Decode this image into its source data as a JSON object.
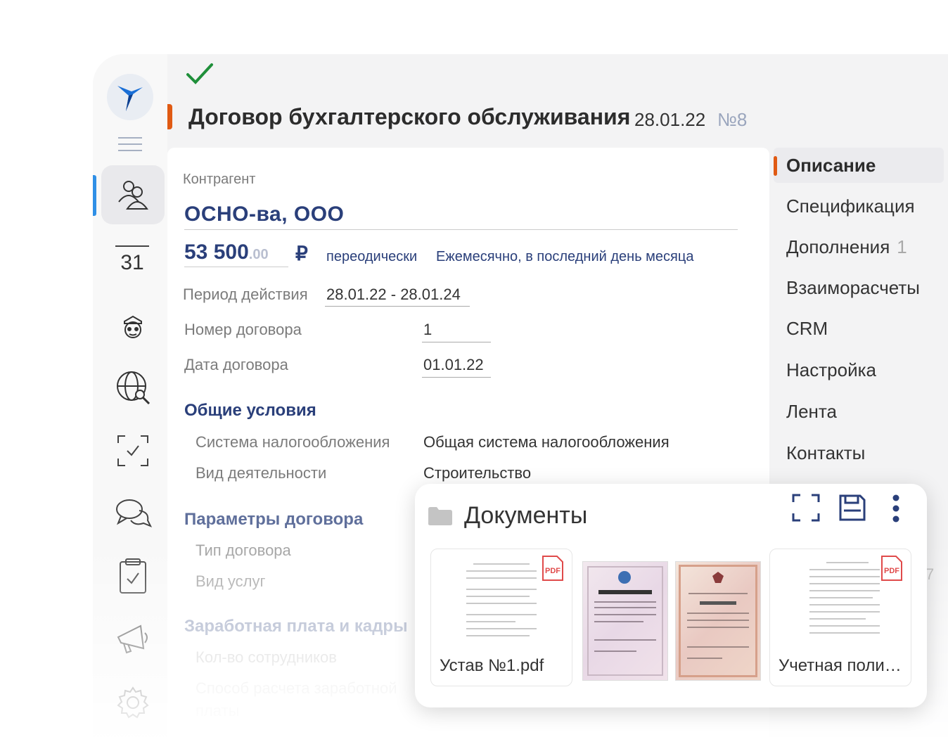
{
  "header": {
    "title": "Договор бухгалтерского обслуживания",
    "date": "28.01.22",
    "number": "№8"
  },
  "sidebar": {
    "calendar_day": "31",
    "items": [
      "users-icon",
      "calendar-icon",
      "agent-icon",
      "globe-search-icon",
      "task-check-icon",
      "chat-icon",
      "clipboard-icon",
      "megaphone-icon",
      "gear-icon"
    ]
  },
  "form": {
    "counterparty_label": "Контрагент",
    "counterparty_value": "ОСНО-ва, ООО",
    "amount_main": "53 500",
    "amount_decimals": ".00",
    "currency": "₽",
    "periodic_label": "переодически",
    "periodic_value": "Ежемесячно, в последний день месяца",
    "period_label": "Период действия",
    "period_value": "28.01.22 - 28.01.24",
    "contract_number_label": "Номер договора",
    "contract_number_value": "1",
    "contract_date_label": "Дата договора",
    "contract_date_value": "01.01.22",
    "section_general": "Общие условия",
    "tax_system_label": "Система налогообложения",
    "tax_system_value": "Общая система налогообложения",
    "activity_label": "Вид деятельности",
    "activity_value": "Строительство",
    "section_params": "Параметры договора",
    "contract_type_label": "Тип договора",
    "services_label": "Вид услуг",
    "section_salary": "Заработная плата и кадры",
    "employees_label": "Кол-во сотрудников",
    "salary_method_label": "Способ расчета заработной",
    "salary_method_label_2": "платы"
  },
  "tabs": [
    {
      "label": "Описание"
    },
    {
      "label": "Спецификация"
    },
    {
      "label": "Дополнения",
      "count": "1"
    },
    {
      "label": "Взаиморасчеты"
    },
    {
      "label": "CRM"
    },
    {
      "label": "Настройка"
    },
    {
      "label": "Лента"
    },
    {
      "label": "Контакты"
    }
  ],
  "documents": {
    "title": "Документы",
    "items": [
      {
        "name": "Устав №1.pdf",
        "type": "pdf"
      },
      {
        "name": "",
        "type": "certificate"
      },
      {
        "name": "",
        "type": "license"
      },
      {
        "name": "Учетная поли…",
        "type": "pdf"
      }
    ],
    "pdf_badge": "PDF"
  },
  "edge_digit": "7",
  "colors": {
    "accent_orange": "#e05a13",
    "brand_blue": "#2a3f7a",
    "active_nav": "#2f8fe6",
    "check_green": "#1f8f3a"
  }
}
